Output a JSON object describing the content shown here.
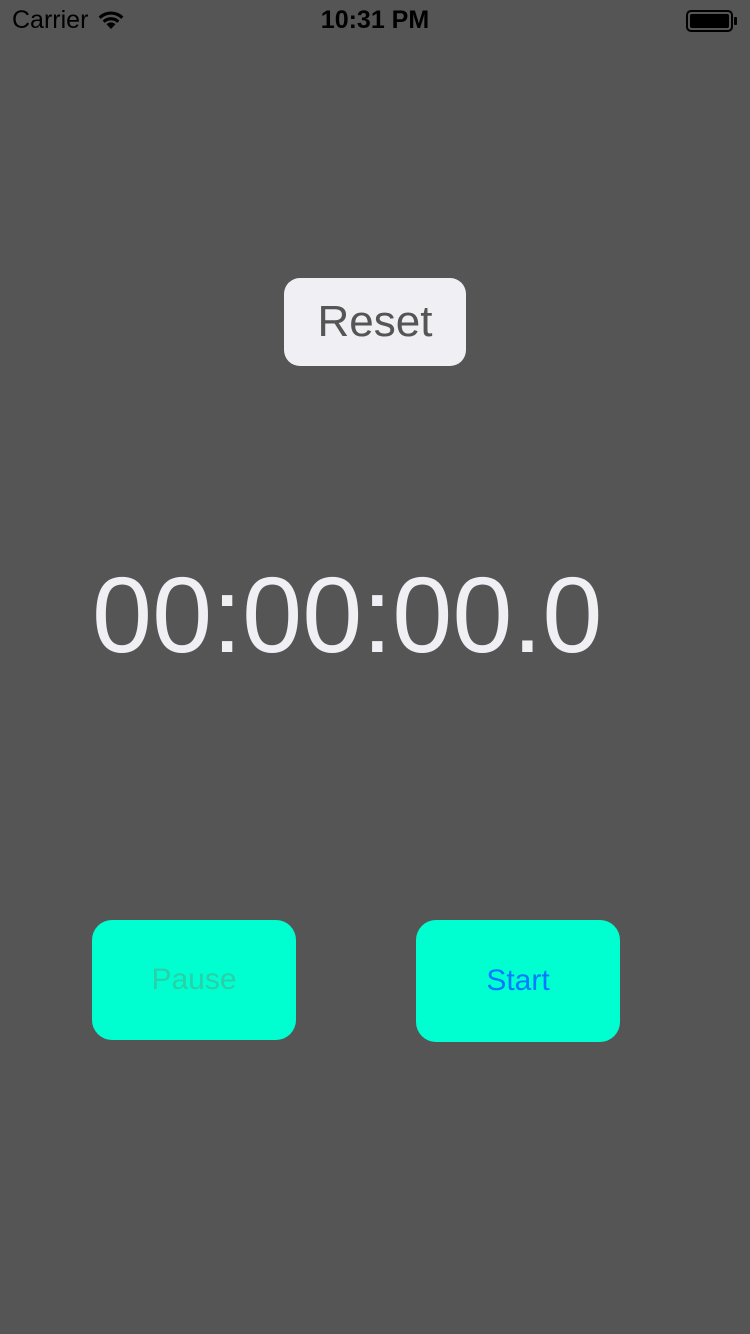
{
  "status_bar": {
    "carrier": "Carrier",
    "time": "10:31 PM",
    "wifi_icon": "wifi-icon",
    "battery_icon": "battery-icon"
  },
  "reset_button": {
    "label": "Reset"
  },
  "timer": {
    "display": "00:00:00.0"
  },
  "pause_button": {
    "label": "Pause"
  },
  "start_button": {
    "label": "Start"
  },
  "colors": {
    "background": "#555555",
    "button_accent": "#00ffd0",
    "start_label": "#007aff",
    "pause_label_disabled": "#2ad0a8",
    "reset_bg": "#efeff4",
    "timer_text": "#efeff4"
  }
}
